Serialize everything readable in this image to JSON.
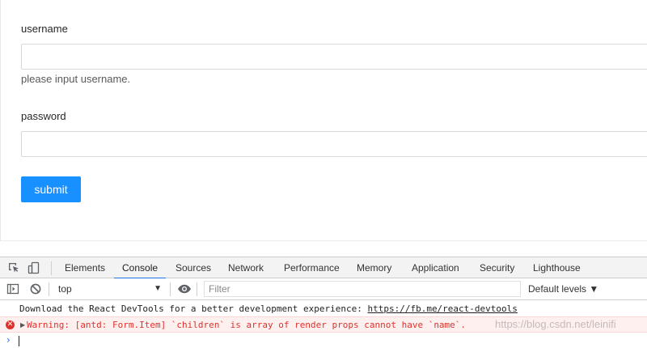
{
  "form": {
    "username_label": "username",
    "username_value": "",
    "username_help": "please input username.",
    "password_label": "password",
    "password_value": "",
    "submit_label": "submit"
  },
  "devtools": {
    "tabs": [
      {
        "label": "Elements",
        "active": false
      },
      {
        "label": "Console",
        "active": true
      },
      {
        "label": "Sources",
        "active": false
      },
      {
        "label": "Network",
        "active": false
      },
      {
        "label": "Performance",
        "active": false
      },
      {
        "label": "Memory",
        "active": false
      },
      {
        "label": "Application",
        "active": false
      },
      {
        "label": "Security",
        "active": false
      },
      {
        "label": "Lighthouse",
        "active": false
      }
    ],
    "context": "top",
    "filter_placeholder": "Filter",
    "levels_label": "Default levels ▼",
    "messages": {
      "info_text": "Download the React DevTools for a better development experience: ",
      "info_link": "https://fb.me/react-devtools",
      "warning_text": "Warning: [antd: Form.Item] `children` is array of render props cannot have `name`."
    },
    "prompt": "›",
    "colors": {
      "accent": "#1a73e8",
      "error": "#e0312a",
      "button": "#1890ff"
    }
  },
  "watermark": "https://blog.csdn.net/leinifi"
}
